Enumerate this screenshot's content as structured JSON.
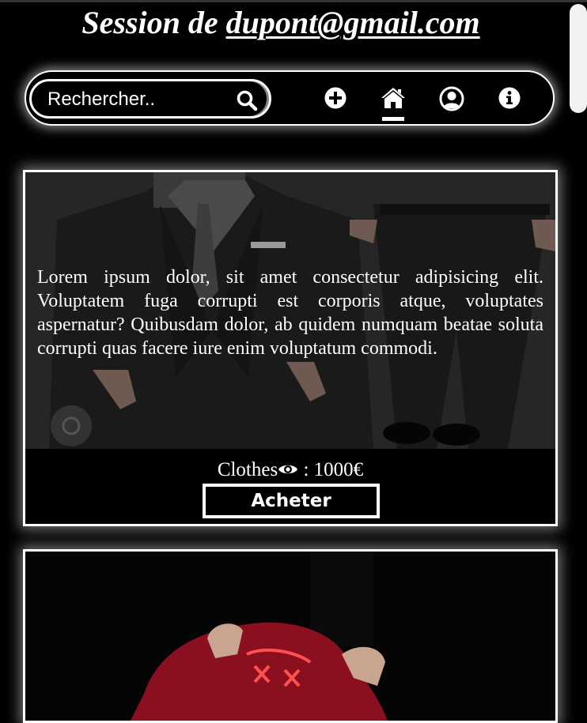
{
  "header": {
    "session_prefix": "Session de ",
    "session_email": "dupont@gmail.com"
  },
  "search": {
    "placeholder": "Rechercher.."
  },
  "nav": {
    "icons": [
      "search-icon",
      "plus-circle-icon",
      "home-icon",
      "user-circle-icon",
      "info-circle-icon"
    ],
    "active": "home-icon"
  },
  "products": [
    {
      "description": "Lorem ipsum dolor, sit amet consectetur adipisicing elit. Voluptatem fuga corrupti est corporis atque, voluptates aspernatur? Quibusdam dolor, ab quidem numquam beatae soluta corrupti quas facere iure enim voluptatum commodi.",
      "category": "Clothes",
      "price_text": ": 1000€",
      "buy_label": "Acheter",
      "image": "suit-photo"
    },
    {
      "image": "red-hoodie-mask-photo"
    }
  ],
  "colors": {
    "background": "#000000",
    "foreground": "#ffffff",
    "glow": "#ffffff"
  }
}
